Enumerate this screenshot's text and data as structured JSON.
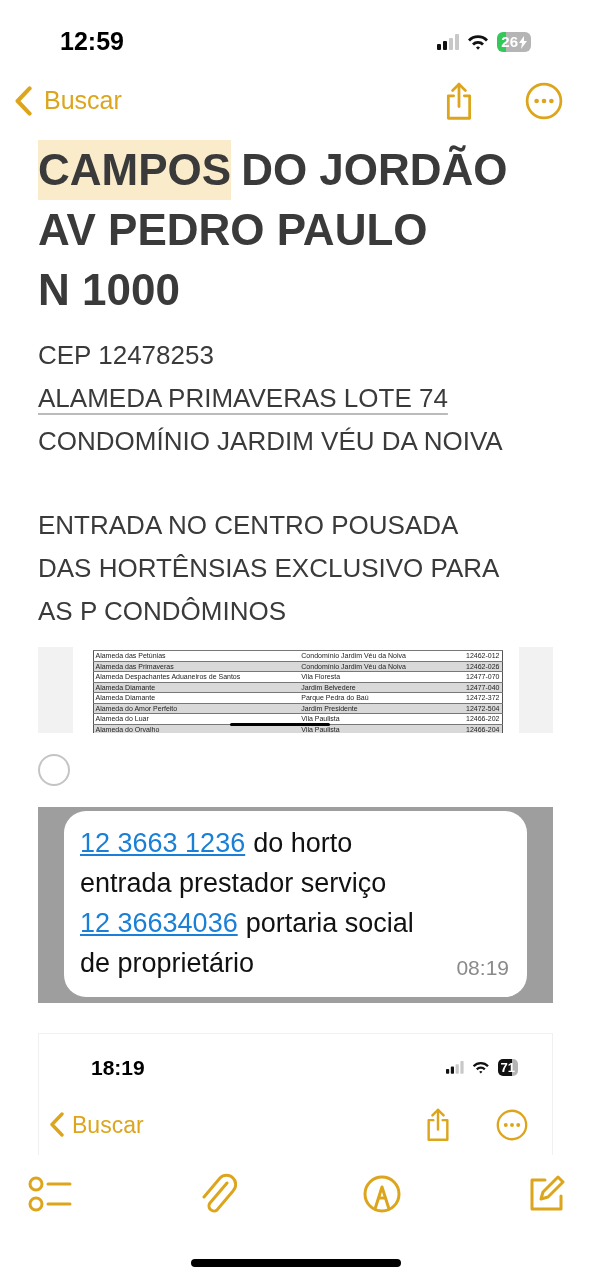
{
  "status_bar": {
    "time": "12:59",
    "battery": "26"
  },
  "nav": {
    "back": "Buscar"
  },
  "heading": [
    {
      "text": "CAMPOS",
      "highlighted": true
    },
    {
      "text": "DO JORDÃO",
      "highlighted": false
    }
  ],
  "heading_lines": [
    "AV PEDRO PAULO",
    "N 1000"
  ],
  "body": [
    {
      "text": "CEP 12478253",
      "underlined": false
    },
    {
      "text": "ALAMEDA PRIMAVERAS LOTE 74",
      "underlined": true
    },
    {
      "text": "CONDOMÍNIO JARDIM VÉU DA NOIVA",
      "underlined": false
    }
  ],
  "paragraph": [
    "ENTRADA NO CENTRO POUSADA",
    "DAS HORTÊNSIAS EXCLUSIVO PARA",
    "AS P CONDÔMINOS"
  ],
  "table": {
    "rows": [
      [
        "Alameda das Petúnias",
        "Condomínio Jardim Véu da Noiva",
        "12462-012"
      ],
      [
        "Alameda das Primaveras",
        "Condomínio Jardim Véu da Noiva",
        "12462-026"
      ],
      [
        "Alameda Despachantes Aduaneiros de Santos",
        "Vila Floresta",
        "12477-070"
      ],
      [
        "Alameda Diamante",
        "Jardim Belvedere",
        "12477-040"
      ],
      [
        "Alameda Diamante",
        "Parque Pedra do Baú",
        "12472-372"
      ],
      [
        "Alameda do Amor Perfeito",
        "Jardim Presidente",
        "12472-504"
      ],
      [
        "Alameda do Luar",
        "Vila Paulista",
        "12466-202"
      ],
      [
        "Alameda do Orvalho",
        "Vila Paulista",
        "12466-204"
      ]
    ]
  },
  "checklist_item": {
    "checked": false
  },
  "message": {
    "lines": [
      [
        {
          "kind": "link",
          "text": "12 3663 1236"
        },
        {
          "kind": "text",
          "text": "do horto"
        }
      ],
      [
        {
          "kind": "text",
          "text": "entrada prestador serviço"
        }
      ],
      [
        {
          "kind": "link",
          "text": "12 36634036"
        },
        {
          "kind": "text",
          "text": "portaria social"
        }
      ],
      [
        {
          "kind": "text",
          "text": "de proprietário"
        }
      ]
    ],
    "time": "08:19"
  },
  "embedded_screenshot": {
    "time": "18:19",
    "battery": "71",
    "back": "Buscar"
  }
}
